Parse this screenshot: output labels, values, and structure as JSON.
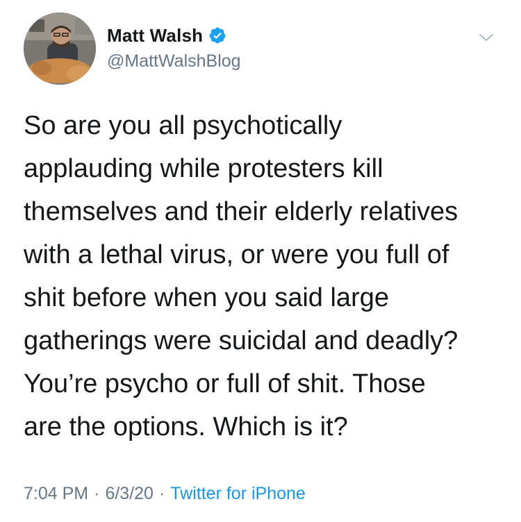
{
  "user": {
    "display_name": "Matt Walsh",
    "handle": "@MattWalshBlog",
    "verified": true
  },
  "tweet": {
    "lines": [
      "So are you all psychotically",
      "applauding while protesters kill",
      "themselves and their elderly relatives",
      "with a lethal virus, or were you full of",
      "shit before when you said large",
      "gatherings were suicidal and deadly?",
      "You’re psycho or full of shit. Those",
      "are the options. Which is it?"
    ],
    "time": "7:04 PM",
    "date": "6/3/20",
    "separator": "·",
    "source": "Twitter for iPhone"
  },
  "colors": {
    "accent": "#1b95e0",
    "text": "#14171a",
    "secondary": "#657786"
  },
  "icons": {
    "verified": "verified-badge-icon",
    "menu": "chevron-down-icon"
  }
}
